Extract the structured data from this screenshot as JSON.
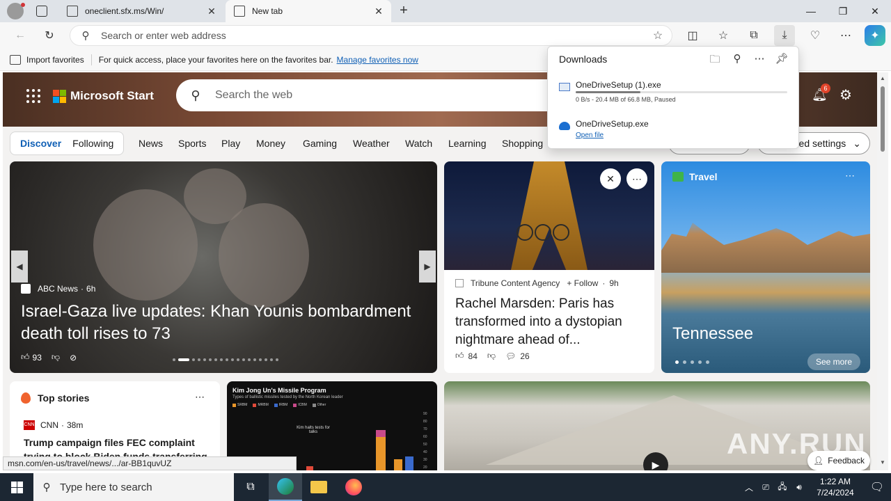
{
  "browser": {
    "tabs": [
      {
        "title": "oneclient.sfx.ms/Win/",
        "close": "✕"
      },
      {
        "title": "New tab",
        "close": "✕"
      }
    ],
    "new_tab": "+",
    "window": {
      "minimize": "—",
      "maximize": "❐",
      "close": "✕"
    },
    "address": {
      "placeholder": "Search or enter web address"
    },
    "favorites_bar": {
      "import_label": "Import favorites",
      "hint": "For quick access, place your favorites here on the favorites bar.",
      "manage_link": "Manage favorites now"
    },
    "status_url": "msn.com/en-us/travel/news/.../ar-BB1quvUZ"
  },
  "downloads": {
    "title": "Downloads",
    "items": [
      {
        "name": "OneDriveSetup (1).exe",
        "status": "0 B/s - 20.4 MB of 66.8 MB, Paused",
        "progress": 0.305
      },
      {
        "name": "OneDriveSetup.exe",
        "action": "Open file"
      }
    ]
  },
  "msn": {
    "brand": "Microsoft Start",
    "search_placeholder": "Search the web",
    "notification_count": "6",
    "feed_tabs": [
      "Discover",
      "Following"
    ],
    "nav": [
      "News",
      "Sports",
      "Play",
      "Money",
      "Gaming",
      "Weather",
      "Watch",
      "Learning",
      "Shopping"
    ],
    "settings_label": "ed settings",
    "main_story": {
      "source": "ABC News",
      "age": "6h",
      "headline": "Israel-Gaza live updates: Khan Younis bombardment death toll rises to 73",
      "likes": "93"
    },
    "story2": {
      "source": "Tribune Content Agency",
      "follow": "+ Follow",
      "age": "9h",
      "headline": "Rachel Marsden: Paris has transformed into a dystopian nightmare ahead of...",
      "likes": "84",
      "comments": "26"
    },
    "travel": {
      "label": "Travel",
      "place": "Tennessee",
      "see_more": "See more"
    },
    "top_stories": {
      "label": "Top stories",
      "source": "CNN",
      "age": "38m",
      "headline": "Trump campaign files FEC complaint trying to block Biden funds transferring"
    },
    "chart_card": {
      "title": "Kim Jong Un's Missile Program",
      "subtitle": "Types of ballistic missiles tested by the North Korean leader",
      "legend": [
        "SRBM",
        "MRBM",
        "IRBM",
        "ICBM",
        "Other"
      ],
      "annotation": "Kim halts tests for talks",
      "yticks": [
        "90",
        "80",
        "70",
        "60",
        "50",
        "40",
        "30",
        "20"
      ]
    },
    "feedback": "Feedback",
    "watermark": "ANY.RUN"
  },
  "taskbar": {
    "search_placeholder": "Type here to search",
    "time": "1:22 AM",
    "date": "7/24/2024"
  },
  "colors": {
    "accent": "#0f5fb5",
    "ms_red": "#f25022",
    "ms_green": "#7fba00",
    "ms_blue": "#00a4ef",
    "ms_yellow": "#ffb900"
  }
}
